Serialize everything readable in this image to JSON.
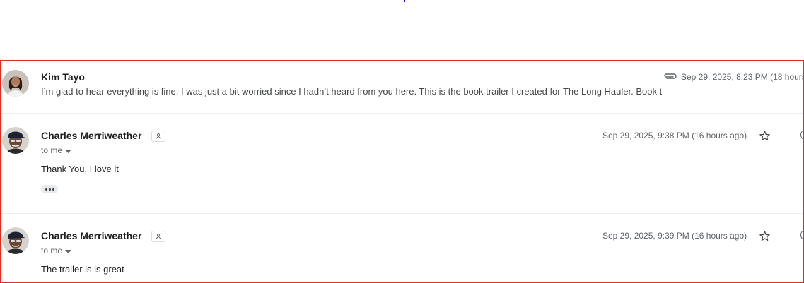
{
  "messages": [
    {
      "sender": "Kim Tayo",
      "snippet": "I’m glad to hear everything is fine, I was just a bit worried since I hadn’t heard from you here. This is the book trailer I created for The Long Hauler. Book t",
      "date": "Sep 29, 2025, 8:23 PM (18 hours",
      "has_attachment": true,
      "avatar_icon": "avatar-woman-photo"
    },
    {
      "sender": "Charles Merriweather",
      "recipient_label": "to me",
      "date": "Sep 29, 2025, 9:38 PM (16 hours ago)",
      "body": "Thank You, I love it",
      "avatar_icon": "avatar-man-cap-photo"
    },
    {
      "sender": "Charles Merriweather",
      "recipient_label": "to me",
      "date": "Sep 29, 2025, 9:39 PM (16 hours ago)",
      "body": "The trailer is is great",
      "avatar_icon": "avatar-man-cap-photo"
    }
  ],
  "colors": {
    "frame_border": "#d93025",
    "divider": "#eceff1",
    "secondary_text": "#5f6368"
  }
}
